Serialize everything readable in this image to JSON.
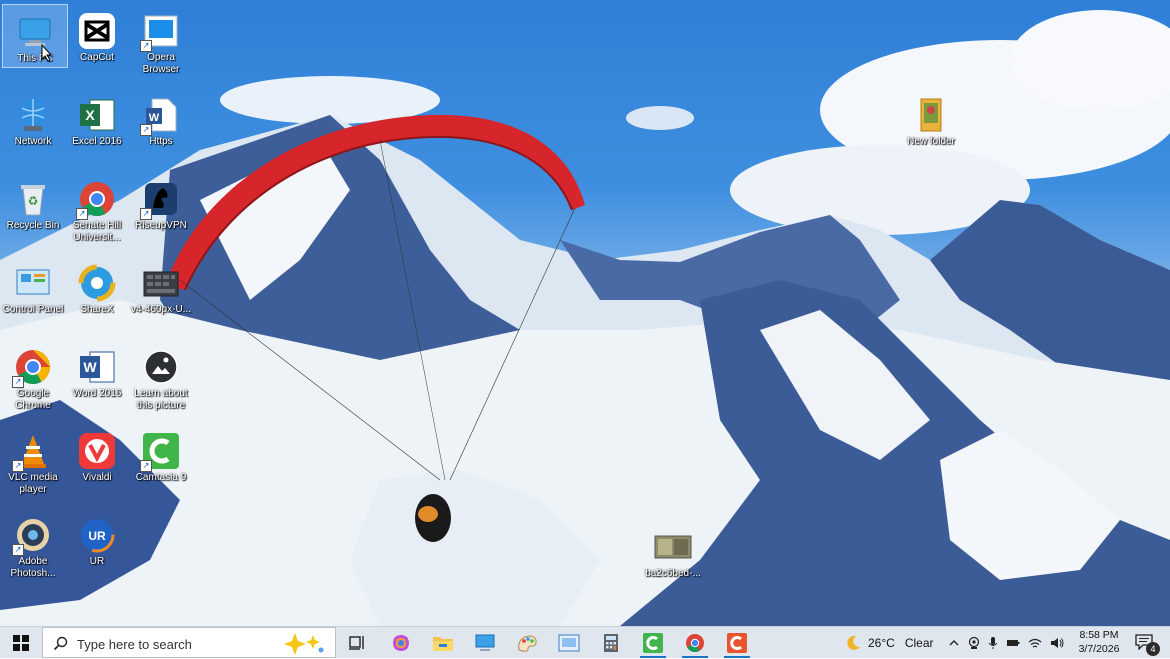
{
  "desktop": {
    "icons": [
      {
        "label": "This PC",
        "icon": "computer-icon"
      },
      {
        "label": "CapCut",
        "icon": "capcut-icon"
      },
      {
        "label": "Opera\nBrowser",
        "icon": "opera-icon"
      },
      {
        "label": "Network",
        "icon": "network-icon"
      },
      {
        "label": "Excel 2016",
        "icon": "excel-icon"
      },
      {
        "label": "Https",
        "icon": "word-doc-icon"
      },
      {
        "label": "Recycle Bin",
        "icon": "recycle-bin-icon"
      },
      {
        "label": "Senate Hill Universit...",
        "icon": "chrome-icon"
      },
      {
        "label": "RiseupVPN",
        "icon": "vpn-icon"
      },
      {
        "label": "Control Panel",
        "icon": "control-panel-icon"
      },
      {
        "label": "ShareX",
        "icon": "sharex-icon"
      },
      {
        "label": "v4-460px-U...",
        "icon": "image-file-icon"
      },
      {
        "label": "Google Chrome",
        "icon": "chrome-icon"
      },
      {
        "label": "Word 2016",
        "icon": "word-icon"
      },
      {
        "label": "Learn about this picture",
        "icon": "camera-icon"
      },
      {
        "label": "VLC media player",
        "icon": "vlc-icon"
      },
      {
        "label": "Vivaldi",
        "icon": "vivaldi-icon"
      },
      {
        "label": "Camtasia 9",
        "icon": "camtasia-icon"
      },
      {
        "label": "Adobe Photosh...",
        "icon": "photoshop-icon"
      },
      {
        "label": "UR",
        "icon": "ur-browser-icon"
      },
      {
        "label": "New folder",
        "icon": "folder-icon"
      },
      {
        "label": "ba2c6bed-...",
        "icon": "image-file-icon"
      }
    ]
  },
  "taskbar": {
    "search_placeholder": "Type here to search",
    "weather_temp": "26°C",
    "weather_text": "Clear",
    "time": "8:58 PM",
    "date": "3/7/2026",
    "notification_count": "4"
  },
  "colors": {
    "taskbar_bg": "#dfe6ee",
    "accent": "#1a73c9"
  }
}
